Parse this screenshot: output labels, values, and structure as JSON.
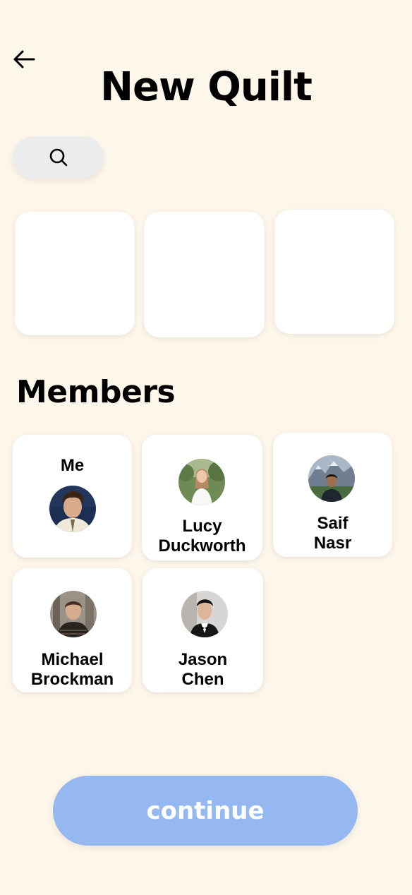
{
  "header": {
    "back_icon": "arrow-left-icon",
    "title": "New Quilt"
  },
  "search": {
    "icon": "search-icon"
  },
  "members_section": {
    "title": "Members"
  },
  "members": [
    {
      "name_line1": "Me",
      "name_line2": "",
      "avatar_icon": "avatar-photo"
    },
    {
      "name_line1": "Lucy",
      "name_line2": "Duckworth",
      "avatar_icon": "avatar-photo"
    },
    {
      "name_line1": "Saif",
      "name_line2": "Nasr",
      "avatar_icon": "avatar-photo"
    },
    {
      "name_line1": "Michael",
      "name_line2": "Brockman",
      "avatar_icon": "avatar-photo"
    },
    {
      "name_line1": "Jason",
      "name_line2": "Chen",
      "avatar_icon": "avatar-photo"
    }
  ],
  "footer": {
    "continue_label": "continue"
  },
  "colors": {
    "background": "#fdf6ea",
    "card": "#ffffff",
    "search_pill": "#ececec",
    "continue_button": "#96b8f0"
  }
}
